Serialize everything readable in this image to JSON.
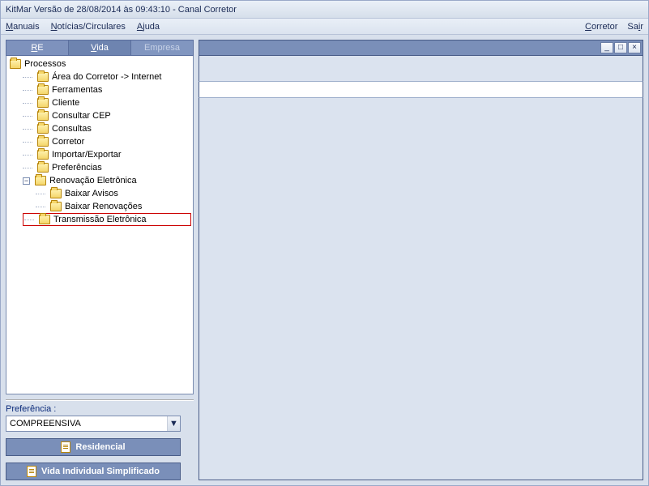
{
  "title": "KitMar  Versão de 28/08/2014 às 09:43:10 - Canal Corretor",
  "menu": {
    "manuais": "Manuais",
    "noticias": "Notícias/Circulares",
    "ajuda": "Ajuda",
    "corretor": "Corretor",
    "sair": "Sair"
  },
  "tabs": {
    "re": "RE",
    "vida": "Vida",
    "dim": "Empresa"
  },
  "tree": {
    "root": "Processos",
    "items": [
      "Área do Corretor -> Internet",
      "Ferramentas",
      "Cliente",
      "Consultar CEP",
      "Consultas",
      "Corretor",
      "Importar/Exportar",
      "Preferências"
    ],
    "renov": "Renovação Eletrônica",
    "renov_children": [
      "Baixar Avisos",
      "Baixar Renovações"
    ],
    "trans": "Transmissão Eletrônica"
  },
  "pref": {
    "label": "Preferência :",
    "value": "COMPREENSIVA"
  },
  "buttons": {
    "residencial": "Residencial",
    "vida_simp": "Vida Individual Simplificado"
  },
  "window_controls": {
    "min": "_",
    "max": "□",
    "close": "×"
  }
}
